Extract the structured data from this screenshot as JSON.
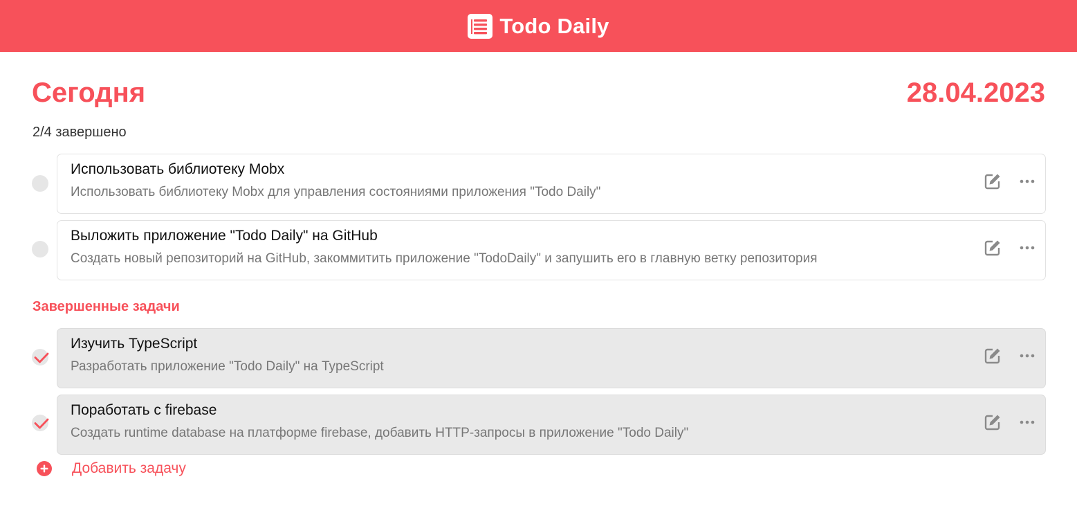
{
  "header": {
    "title": "Todo Daily",
    "icon": "list-doc-icon"
  },
  "main": {
    "title": "Сегодня",
    "date": "28.04.2023",
    "progress": "2/4 завершено",
    "completed_section_title": "Завершенные задачи",
    "add_task_label": "Добавить задачу"
  },
  "tasks": [
    {
      "title": "Использовать библиотеку Mobx",
      "description": "Использовать библиотеку Mobx для управления состояниями приложения \"Todo Daily\"",
      "done": false
    },
    {
      "title": "Выложить приложение \"Todo Daily\" на GitHub",
      "description": "Создать новый репозиторий на GitHub, закоммитить приложение \"TodoDaily\" и запушить его в главную ветку репозитория",
      "done": false
    }
  ],
  "completed_tasks": [
    {
      "title": "Изучить TypeScript",
      "description": "Разработать приложение \"Todo Daily\" на TypeScript",
      "done": true
    },
    {
      "title": "Поработать с firebase",
      "description": "Создать runtime database на платформе firebase, добавить HTTP-запросы в приложение \"Todo Daily\"",
      "done": true
    }
  ],
  "colors": {
    "accent": "#f7515a",
    "done_card": "#e9e9e9",
    "check_bg": "#e6e6e6"
  },
  "icons": {
    "edit": "edit-icon",
    "more": "more-dots-icon",
    "check": "checkmark-icon",
    "add": "plus-circle-icon"
  }
}
